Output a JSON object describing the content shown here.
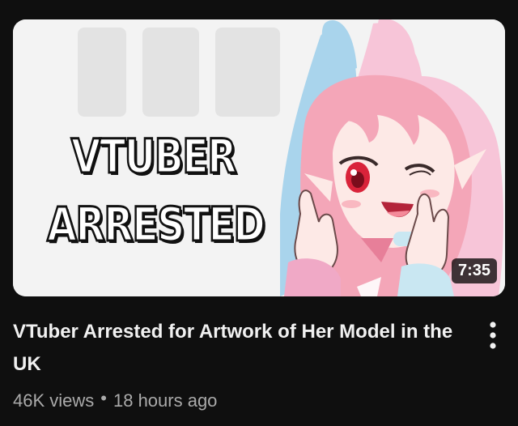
{
  "video": {
    "thumbnail_text_line1": "VTUBER",
    "thumbnail_text_line2": "ARRESTED",
    "duration": "7:35",
    "title": "VTuber Arrested for Artwork of Her Model in the UK",
    "views": "46K views",
    "separator": "•",
    "age": "18 hours ago",
    "menu_icon": "more-vert-icon"
  },
  "colors": {
    "background": "#0f0f0f",
    "title": "#f1f1f1",
    "meta": "#aaaaaa",
    "hood_blue": "#a9d4ec",
    "hood_pink": "#f7c5d8",
    "hair_pink": "#f4a6b8",
    "eye_red": "#d9233a"
  }
}
